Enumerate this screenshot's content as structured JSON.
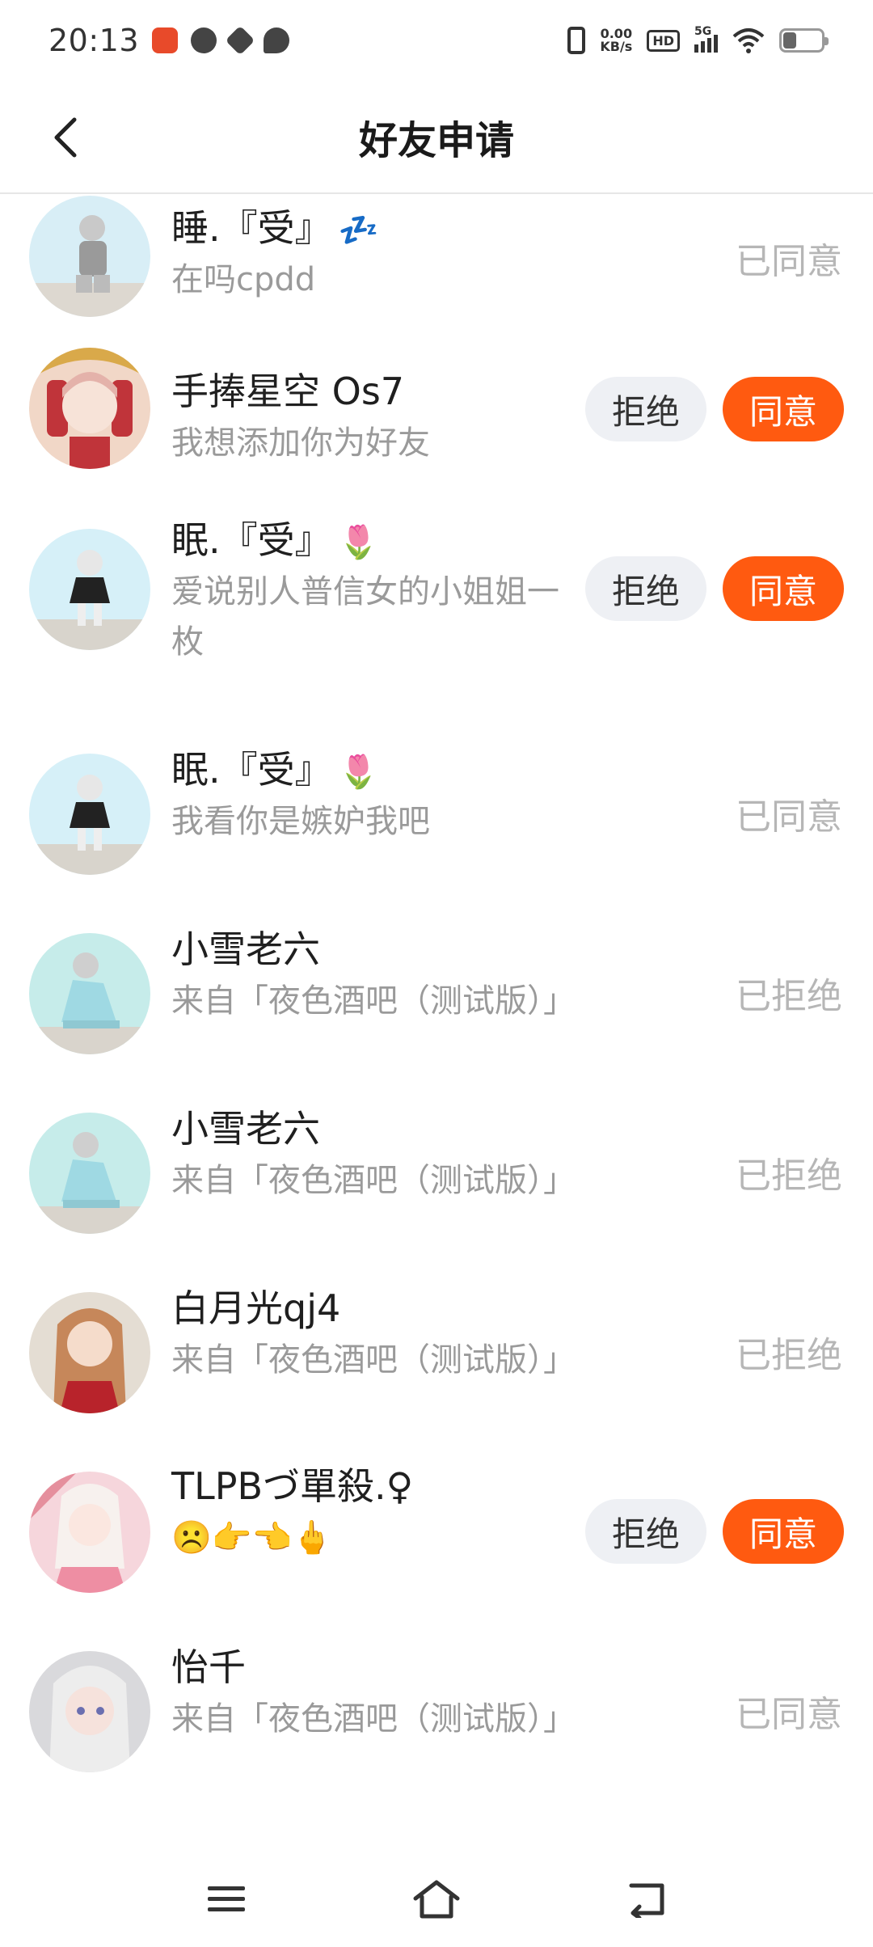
{
  "status_bar": {
    "time": "20:13",
    "net_speed_value": "0.00",
    "net_speed_unit": "KB/s",
    "hd_label": "HD",
    "network": "5G",
    "battery_level": 0.35
  },
  "header": {
    "title": "好友申请"
  },
  "buttons": {
    "reject": "拒绝",
    "accept": "同意"
  },
  "requests": [
    {
      "name": "睡.『受』",
      "name_emoji": "💤",
      "message": "在吗cpdd",
      "status": "已同意",
      "avatar_bg": "#d8eef6"
    },
    {
      "name": "手捧星空 Os7",
      "name_emoji": "",
      "message": "我想添加你为好友",
      "status": "",
      "avatar_bg": "#f1d7c7"
    },
    {
      "name": "眠.『受』",
      "name_emoji": "🌷",
      "message": "爱说别人普信女的小姐姐一枚",
      "status": "",
      "avatar_bg": "#d6f0f8"
    },
    {
      "name": "眠.『受』",
      "name_emoji": "🌷",
      "message": "我看你是嫉妒我吧",
      "status": "已同意",
      "avatar_bg": "#d6f0f8"
    },
    {
      "name": "小雪老六",
      "name_emoji": "",
      "message": "来自「夜色酒吧（测试版）」",
      "status": "已拒绝",
      "avatar_bg": "#c6ecea"
    },
    {
      "name": "小雪老六",
      "name_emoji": "",
      "message": "来自「夜色酒吧（测试版）」",
      "status": "已拒绝",
      "avatar_bg": "#c6ecea"
    },
    {
      "name": "白月光qj4",
      "name_emoji": "",
      "message": "来自「夜色酒吧（测试版）」",
      "status": "已拒绝",
      "avatar_bg": "#e4ddd3"
    },
    {
      "name": "TLPBづ單殺.♀",
      "name_emoji": "",
      "message": "☹️👉👈🖕",
      "status": "",
      "avatar_bg": "#f6d6dc"
    },
    {
      "name": "怡千",
      "name_emoji": "",
      "message": "来自「夜色酒吧（测试版）」",
      "status": "已同意",
      "avatar_bg": "#d9d9dc"
    }
  ],
  "navbar": {
    "items": [
      "menu-icon",
      "home-icon",
      "back-icon"
    ]
  },
  "colors": {
    "accent": "#ff5a10",
    "reject_bg": "#eef0f4",
    "status_text": "#b6b6b6",
    "sub_text": "#9a9a9a"
  }
}
